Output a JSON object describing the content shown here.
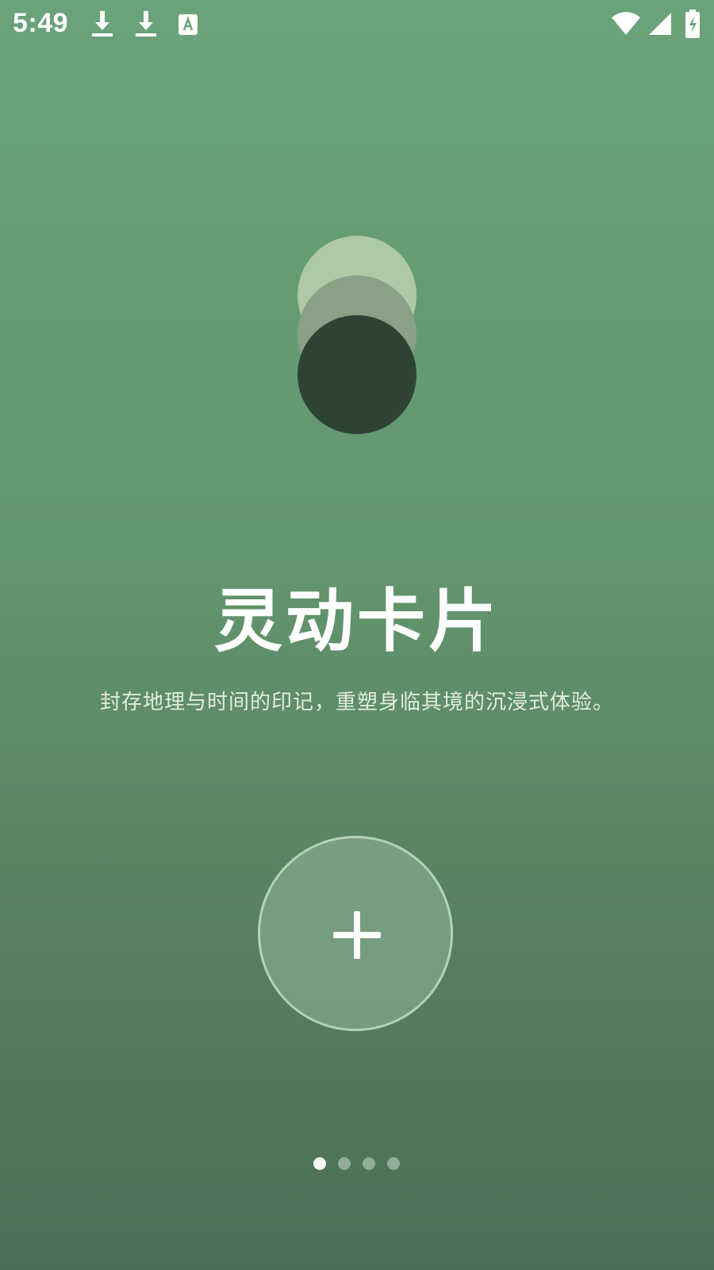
{
  "status_bar": {
    "time": "5:49",
    "icons": [
      "download-icon",
      "download-icon",
      "keyboard-a-icon",
      "wifi-icon",
      "signal-icon",
      "battery-charging-icon"
    ]
  },
  "intro": {
    "title": "灵动卡片",
    "subtitle": "封存地理与时间的印记，重塑身临其境的沉浸式体验。"
  },
  "add_button": {
    "icon": "plus-icon"
  },
  "pager": {
    "total": 4,
    "active_index": 0
  },
  "colors": {
    "bg_top": "#6aa37a",
    "bg_bottom": "#4b6f55",
    "logo_light": "#aec9a5",
    "logo_mid": "#8aa087",
    "logo_dark": "#2f4335"
  }
}
